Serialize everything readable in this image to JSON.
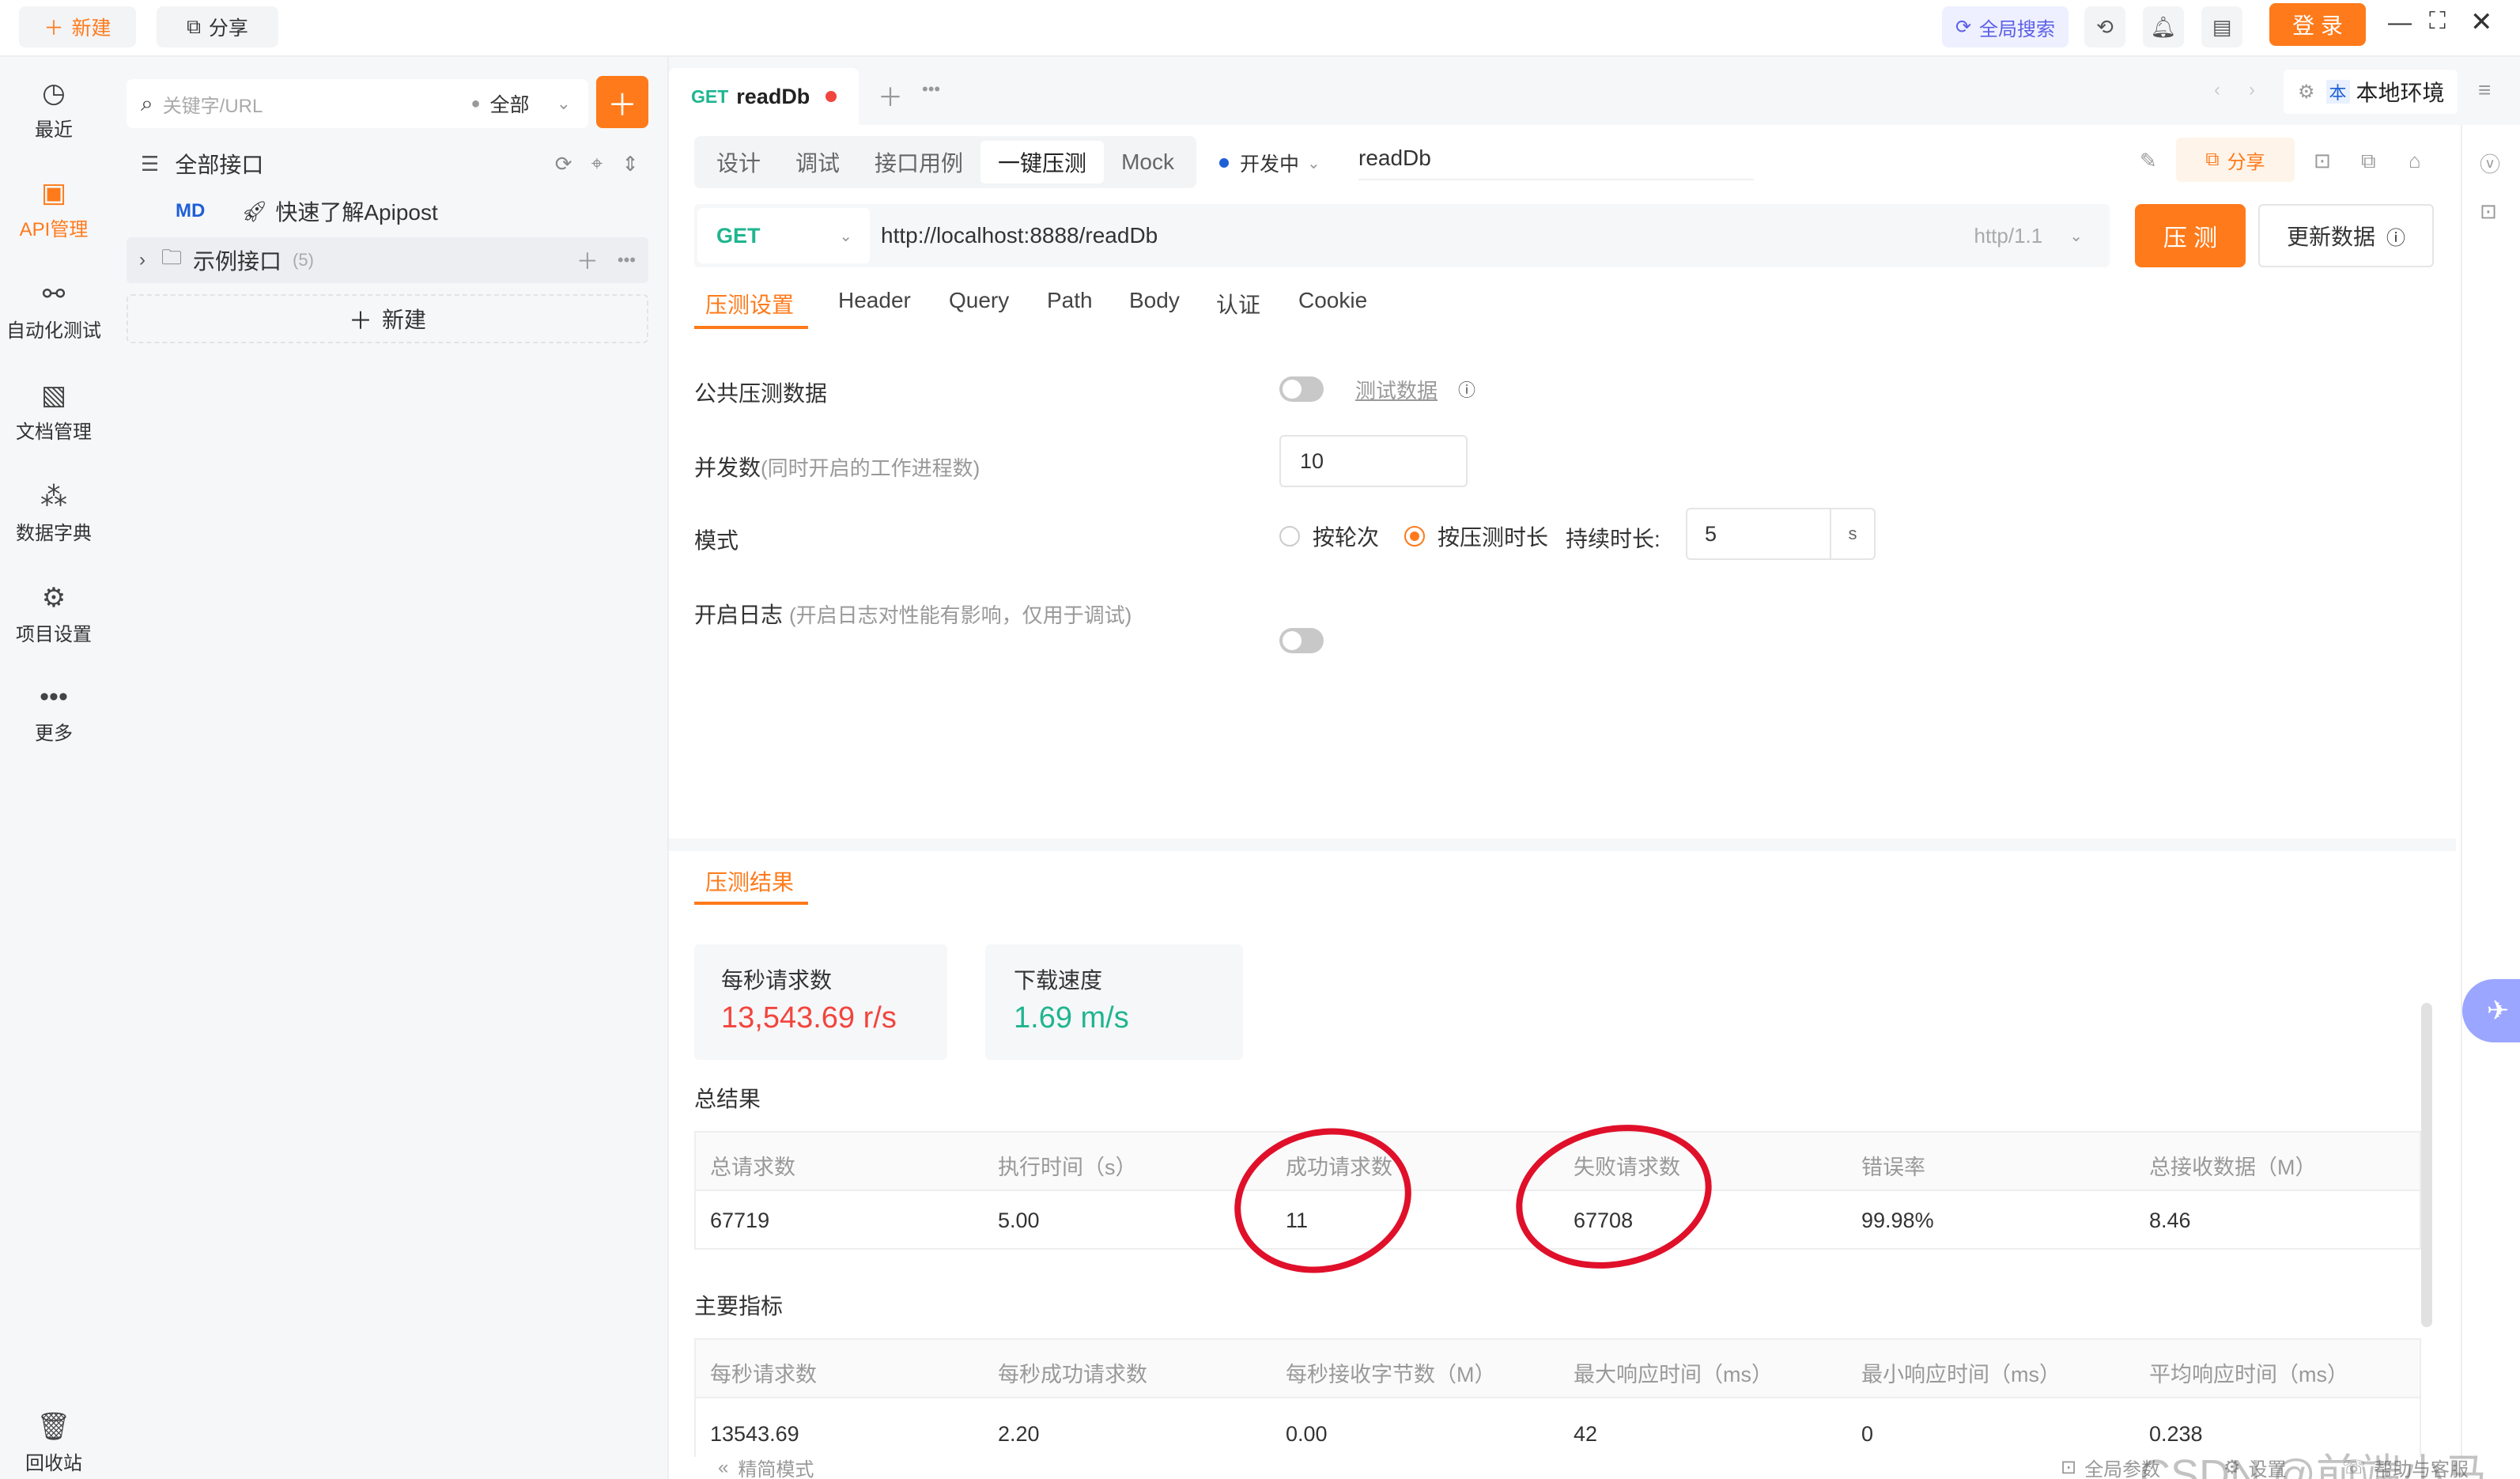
{
  "topbar": {
    "new_label": "新建",
    "share_label": "分享",
    "global_search": "全局搜索",
    "login": "登 录",
    "accent": "#ff7a1a"
  },
  "leftnav": [
    {
      "label": "最近",
      "icon": "clock-icon"
    },
    {
      "label": "API管理",
      "icon": "api-icon"
    },
    {
      "label": "自动化测试",
      "icon": "automation-icon"
    },
    {
      "label": "文档管理",
      "icon": "document-icon"
    },
    {
      "label": "数据字典",
      "icon": "dictionary-icon"
    },
    {
      "label": "项目设置",
      "icon": "settings-icon"
    },
    {
      "label": "更多",
      "icon": "more-icon"
    },
    {
      "label": "回收站",
      "icon": "trash-icon"
    }
  ],
  "tree": {
    "search_placeholder": "关键字/URL",
    "filter": "全部",
    "all_apis": "全部接口",
    "md_badge": "MD",
    "quick_start": "快速了解Apipost",
    "example_folder": "示例接口",
    "example_count": "(5)",
    "new_label": "新建"
  },
  "doc_tab": {
    "method": "GET",
    "name": "readDb",
    "env_badge": "本",
    "env": "本地环境"
  },
  "mode_tabs": [
    "设计",
    "调试",
    "接口用例",
    "一键压测",
    "Mock"
  ],
  "status": "开发中",
  "api_name": "readDb",
  "share_label": "分享",
  "request": {
    "method": "GET",
    "url": "http://localhost:8888/readDb",
    "protocol": "http/1.1",
    "run_label": "压 测",
    "update_label": "更新数据"
  },
  "subtabs": [
    "压测设置",
    "Header",
    "Query",
    "Path",
    "Body",
    "认证",
    "Cookie"
  ],
  "settings": {
    "public_data": "公共压测数据",
    "test_data_link": "测试数据",
    "concurrency_label": "并发数",
    "concurrency_hint": "(同时开启的工作进程数)",
    "concurrency_value": "10",
    "mode_label": "模式",
    "mode_by_rounds": "按轮次",
    "mode_by_duration": "按压测时长",
    "duration_label": "持续时长:",
    "duration_value": "5",
    "duration_unit": "s",
    "log_label": "开启日志",
    "log_hint": "(开启日志对性能有影响，仅用于调试)"
  },
  "results": {
    "tab": "压测结果",
    "rps_label": "每秒请求数",
    "rps_value": "13,543.69 r/s",
    "download_label": "下载速度",
    "download_value": "1.69 m/s",
    "rps_color": "#f2453d",
    "download_color": "#1fb58f",
    "summary_title": "总结果",
    "summary_headers": [
      "总请求数",
      "执行时间（s）",
      "成功请求数",
      "失败请求数",
      "错误率",
      "总接收数据（M）"
    ],
    "summary_values": [
      "67719",
      "5.00",
      "11",
      "67708",
      "99.98%",
      "8.46"
    ],
    "metrics_title": "主要指标",
    "metrics_headers": [
      "每秒请求数",
      "每秒成功请求数",
      "每秒接收字节数（M）",
      "最大响应时间（ms）",
      "最小响应时间（ms）",
      "平均响应时间（ms）"
    ],
    "metrics_values": [
      "13543.69",
      "2.20",
      "0.00",
      "42",
      "0",
      "0.238"
    ]
  },
  "footer": {
    "simple_mode": "精简模式",
    "global_params": "全局参数",
    "settings": "设置",
    "help": "帮助与客服",
    "watermark": "CSDN @前端小马"
  }
}
